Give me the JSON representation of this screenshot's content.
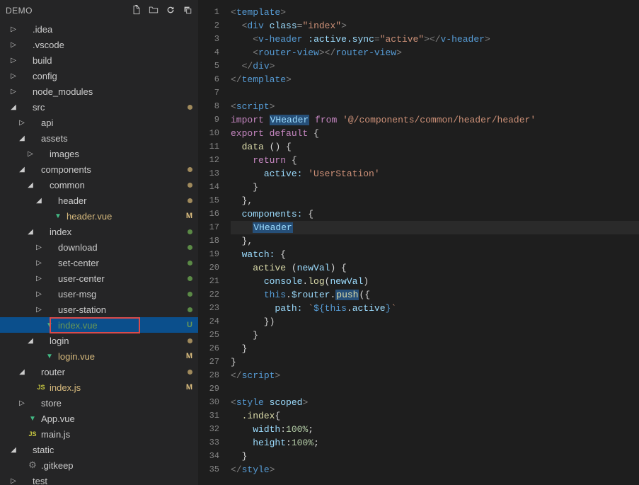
{
  "sidebar": {
    "title": "DEMO",
    "tree": [
      {
        "indent": 0,
        "type": "folder",
        "expanded": false,
        "label": ".idea"
      },
      {
        "indent": 0,
        "type": "folder",
        "expanded": false,
        "label": ".vscode"
      },
      {
        "indent": 0,
        "type": "folder",
        "expanded": false,
        "label": "build"
      },
      {
        "indent": 0,
        "type": "folder",
        "expanded": false,
        "label": "config"
      },
      {
        "indent": 0,
        "type": "folder",
        "expanded": false,
        "label": "node_modules"
      },
      {
        "indent": 0,
        "type": "folder",
        "expanded": true,
        "label": "src",
        "dot": "tan"
      },
      {
        "indent": 1,
        "type": "folder",
        "expanded": false,
        "label": "api"
      },
      {
        "indent": 1,
        "type": "folder",
        "expanded": true,
        "label": "assets"
      },
      {
        "indent": 2,
        "type": "folder",
        "expanded": false,
        "label": "images"
      },
      {
        "indent": 1,
        "type": "folder",
        "expanded": true,
        "label": "components",
        "dot": "tan"
      },
      {
        "indent": 2,
        "type": "folder",
        "expanded": true,
        "label": "common",
        "dot": "tan"
      },
      {
        "indent": 3,
        "type": "folder",
        "expanded": true,
        "label": "header",
        "dot": "tan"
      },
      {
        "indent": 4,
        "type": "file",
        "icon": "vue",
        "label": "header.vue",
        "status": "M",
        "modified": true
      },
      {
        "indent": 2,
        "type": "folder",
        "expanded": true,
        "label": "index",
        "dot": "green"
      },
      {
        "indent": 3,
        "type": "folder",
        "expanded": false,
        "label": "download",
        "dot": "green"
      },
      {
        "indent": 3,
        "type": "folder",
        "expanded": false,
        "label": "set-center",
        "dot": "green"
      },
      {
        "indent": 3,
        "type": "folder",
        "expanded": false,
        "label": "user-center",
        "dot": "green"
      },
      {
        "indent": 3,
        "type": "folder",
        "expanded": false,
        "label": "user-msg",
        "dot": "green"
      },
      {
        "indent": 3,
        "type": "folder",
        "expanded": false,
        "label": "user-station",
        "dot": "green"
      },
      {
        "indent": 3,
        "type": "file",
        "icon": "vue",
        "label": "index.vue",
        "status": "U",
        "untracked": true,
        "selected": true,
        "boxed": true
      },
      {
        "indent": 2,
        "type": "folder",
        "expanded": true,
        "label": "login",
        "dot": "tan"
      },
      {
        "indent": 3,
        "type": "file",
        "icon": "vue",
        "label": "login.vue",
        "status": "M",
        "modified": true
      },
      {
        "indent": 1,
        "type": "folder",
        "expanded": true,
        "label": "router",
        "dot": "tan"
      },
      {
        "indent": 2,
        "type": "file",
        "icon": "js",
        "label": "index.js",
        "status": "M",
        "modified": true
      },
      {
        "indent": 1,
        "type": "folder",
        "expanded": false,
        "label": "store"
      },
      {
        "indent": 1,
        "type": "file",
        "icon": "vue",
        "label": "App.vue"
      },
      {
        "indent": 1,
        "type": "file",
        "icon": "js",
        "label": "main.js"
      },
      {
        "indent": 0,
        "type": "folder",
        "expanded": true,
        "label": "static"
      },
      {
        "indent": 1,
        "type": "file",
        "icon": "gear",
        "label": ".gitkeep"
      },
      {
        "indent": 0,
        "type": "folder",
        "expanded": false,
        "label": "test"
      }
    ]
  },
  "editor": {
    "current_line": 17,
    "lines": [
      {
        "n": 1,
        "tokens": [
          [
            "<",
            "punct"
          ],
          [
            "template",
            "tag"
          ],
          [
            ">",
            "punct"
          ]
        ]
      },
      {
        "n": 2,
        "tokens": [
          [
            "  ",
            ""
          ],
          [
            "<",
            "punct"
          ],
          [
            "div",
            "tag"
          ],
          [
            " ",
            ""
          ],
          [
            "class",
            "attr"
          ],
          [
            "=",
            "punct"
          ],
          [
            "\"index\"",
            "str"
          ],
          [
            ">",
            "punct"
          ]
        ]
      },
      {
        "n": 3,
        "tokens": [
          [
            "    ",
            ""
          ],
          [
            "<",
            "punct"
          ],
          [
            "v-header",
            "tag"
          ],
          [
            " ",
            ""
          ],
          [
            ":active.sync",
            "attr"
          ],
          [
            "=",
            "punct"
          ],
          [
            "\"active\"",
            "str"
          ],
          [
            "></",
            "punct"
          ],
          [
            "v-header",
            "tag"
          ],
          [
            ">",
            "punct"
          ]
        ]
      },
      {
        "n": 4,
        "tokens": [
          [
            "    ",
            ""
          ],
          [
            "<",
            "punct"
          ],
          [
            "router-view",
            "tag"
          ],
          [
            "></",
            "punct"
          ],
          [
            "router-view",
            "tag"
          ],
          [
            ">",
            "punct"
          ]
        ]
      },
      {
        "n": 5,
        "tokens": [
          [
            "  ",
            ""
          ],
          [
            "</",
            "punct"
          ],
          [
            "div",
            "tag"
          ],
          [
            ">",
            "punct"
          ]
        ]
      },
      {
        "n": 6,
        "tokens": [
          [
            "</",
            "punct"
          ],
          [
            "template",
            "tag"
          ],
          [
            ">",
            "punct"
          ]
        ]
      },
      {
        "n": 7,
        "tokens": []
      },
      {
        "n": 8,
        "tokens": [
          [
            "<",
            "punct"
          ],
          [
            "script",
            "tag"
          ],
          [
            ">",
            "punct"
          ]
        ]
      },
      {
        "n": 9,
        "tokens": [
          [
            "import",
            "kw"
          ],
          [
            " ",
            "plain"
          ],
          [
            "VHeader",
            "id",
            "hl"
          ],
          [
            " ",
            "plain"
          ],
          [
            "from",
            "kw"
          ],
          [
            " ",
            "plain"
          ],
          [
            "'@/components/common/header/header'",
            "str"
          ]
        ]
      },
      {
        "n": 10,
        "tokens": [
          [
            "export",
            "kw"
          ],
          [
            " ",
            "plain"
          ],
          [
            "default",
            "kw"
          ],
          [
            " ",
            "plain"
          ],
          [
            "{",
            "plain"
          ]
        ]
      },
      {
        "n": 11,
        "tokens": [
          [
            "  ",
            "plain"
          ],
          [
            "data",
            "fn"
          ],
          [
            " ",
            "plain"
          ],
          [
            "() {",
            "plain"
          ]
        ]
      },
      {
        "n": 12,
        "tokens": [
          [
            "    ",
            "plain"
          ],
          [
            "return",
            "kw"
          ],
          [
            " {",
            "plain"
          ]
        ]
      },
      {
        "n": 13,
        "tokens": [
          [
            "      ",
            "plain"
          ],
          [
            "active:",
            "prop"
          ],
          [
            " ",
            "plain"
          ],
          [
            "'UserStation'",
            "str"
          ]
        ]
      },
      {
        "n": 14,
        "tokens": [
          [
            "    }",
            "plain"
          ]
        ]
      },
      {
        "n": 15,
        "tokens": [
          [
            "  },",
            "plain"
          ]
        ]
      },
      {
        "n": 16,
        "tokens": [
          [
            "  ",
            "plain"
          ],
          [
            "components:",
            "prop"
          ],
          [
            " {",
            "plain"
          ]
        ]
      },
      {
        "n": 17,
        "tokens": [
          [
            "    ",
            "plain"
          ],
          [
            "VHeader",
            "id",
            "hl"
          ]
        ]
      },
      {
        "n": 18,
        "tokens": [
          [
            "  },",
            "plain"
          ]
        ]
      },
      {
        "n": 19,
        "tokens": [
          [
            "  ",
            "plain"
          ],
          [
            "watch:",
            "prop"
          ],
          [
            " {",
            "plain"
          ]
        ]
      },
      {
        "n": 20,
        "tokens": [
          [
            "    ",
            "plain"
          ],
          [
            "active",
            "fn"
          ],
          [
            " (",
            "plain"
          ],
          [
            "newVal",
            "id"
          ],
          [
            ") {",
            "plain"
          ]
        ]
      },
      {
        "n": 21,
        "tokens": [
          [
            "      ",
            "plain"
          ],
          [
            "console",
            "id"
          ],
          [
            ".",
            "plain"
          ],
          [
            "log",
            "fn"
          ],
          [
            "(",
            "plain"
          ],
          [
            "newVal",
            "id"
          ],
          [
            ")",
            "plain"
          ]
        ]
      },
      {
        "n": 22,
        "tokens": [
          [
            "      ",
            "plain"
          ],
          [
            "this",
            "kw2"
          ],
          [
            ".",
            "plain"
          ],
          [
            "$router",
            "id"
          ],
          [
            ".",
            "plain"
          ],
          [
            "push",
            "fn",
            "hl"
          ],
          [
            "({",
            "plain"
          ]
        ]
      },
      {
        "n": 23,
        "tokens": [
          [
            "        ",
            "plain"
          ],
          [
            "path:",
            "prop"
          ],
          [
            " ",
            "plain"
          ],
          [
            "`",
            "str"
          ],
          [
            "${",
            "kw2"
          ],
          [
            "this",
            "kw2"
          ],
          [
            ".",
            "plain"
          ],
          [
            "active",
            "id"
          ],
          [
            "}",
            "kw2"
          ],
          [
            "`",
            "str"
          ]
        ]
      },
      {
        "n": 24,
        "tokens": [
          [
            "      })",
            "plain"
          ]
        ]
      },
      {
        "n": 25,
        "tokens": [
          [
            "    }",
            "plain"
          ]
        ]
      },
      {
        "n": 26,
        "tokens": [
          [
            "  }",
            "plain"
          ]
        ]
      },
      {
        "n": 27,
        "tokens": [
          [
            "}",
            "plain"
          ]
        ]
      },
      {
        "n": 28,
        "tokens": [
          [
            "</",
            "punct"
          ],
          [
            "script",
            "tag"
          ],
          [
            ">",
            "punct"
          ]
        ]
      },
      {
        "n": 29,
        "tokens": []
      },
      {
        "n": 30,
        "tokens": [
          [
            "<",
            "punct"
          ],
          [
            "style",
            "tag"
          ],
          [
            " ",
            ""
          ],
          [
            "scoped",
            "attr"
          ],
          [
            ">",
            "punct"
          ]
        ]
      },
      {
        "n": 31,
        "tokens": [
          [
            "  ",
            "plain"
          ],
          [
            ".index",
            "fn"
          ],
          [
            "{",
            "plain"
          ]
        ]
      },
      {
        "n": 32,
        "tokens": [
          [
            "    ",
            "plain"
          ],
          [
            "width",
            "prop"
          ],
          [
            ":",
            "plain"
          ],
          [
            "100%",
            "num"
          ],
          [
            ";",
            "plain"
          ]
        ]
      },
      {
        "n": 33,
        "tokens": [
          [
            "    ",
            "plain"
          ],
          [
            "height",
            "prop"
          ],
          [
            ":",
            "plain"
          ],
          [
            "100%",
            "num"
          ],
          [
            ";",
            "plain"
          ]
        ]
      },
      {
        "n": 34,
        "tokens": [
          [
            "  }",
            "plain"
          ]
        ]
      },
      {
        "n": 35,
        "tokens": [
          [
            "</",
            "punct"
          ],
          [
            "style",
            "tag"
          ],
          [
            ">",
            "punct"
          ]
        ]
      }
    ]
  }
}
